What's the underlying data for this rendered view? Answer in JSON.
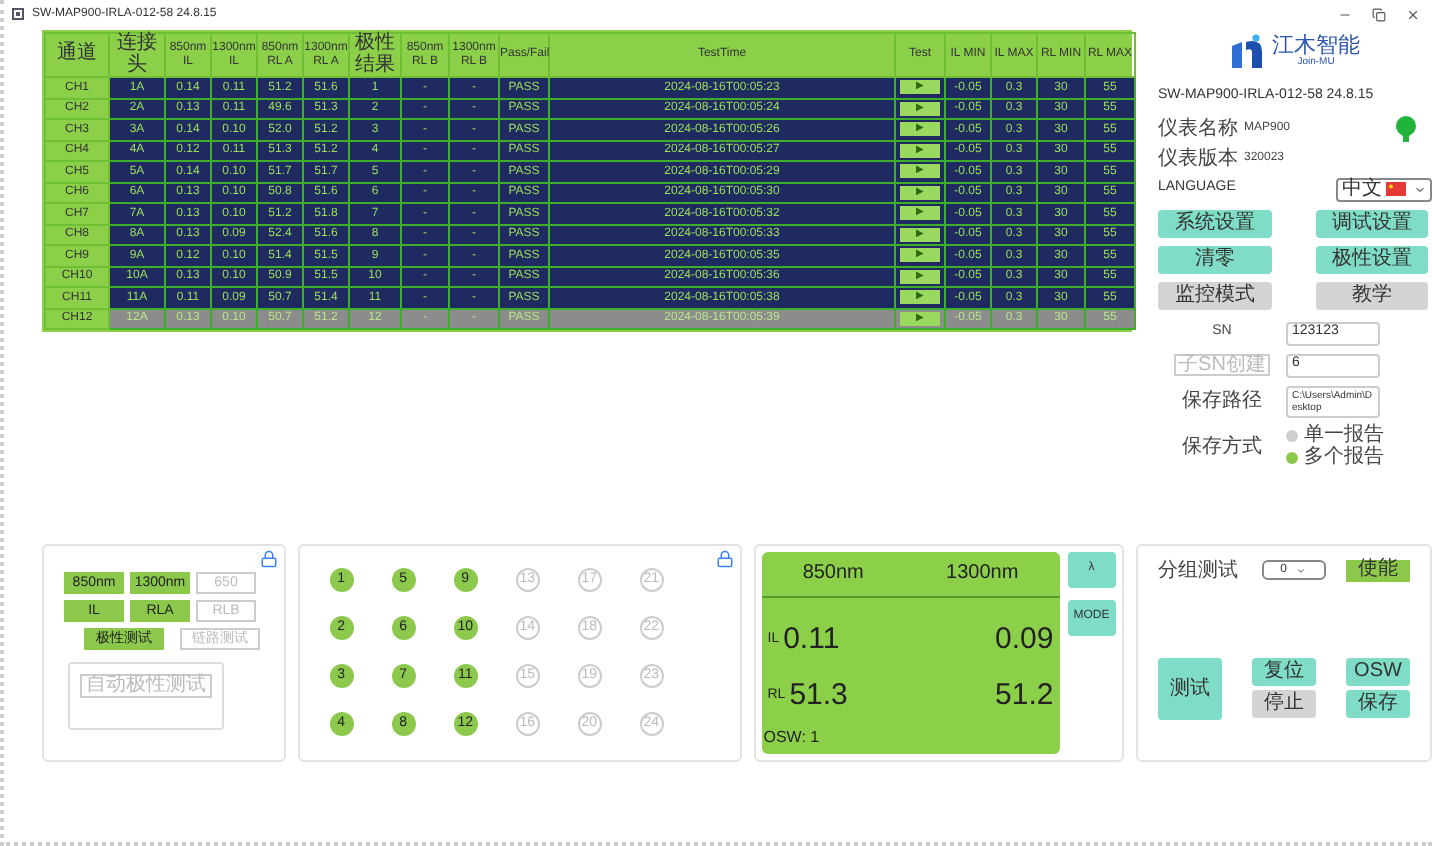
{
  "window": {
    "title": "SW-MAP900-IRLA-012-58 24.8.15"
  },
  "table": {
    "columns": [
      {
        "lines": [
          "通道"
        ]
      },
      {
        "lines": [
          "连接头"
        ]
      },
      {
        "lines": [
          "850nm",
          "IL"
        ]
      },
      {
        "lines": [
          "1300nm",
          "IL"
        ]
      },
      {
        "lines": [
          "850nm",
          "RL A"
        ]
      },
      {
        "lines": [
          "1300nm",
          "RL A"
        ]
      },
      {
        "lines": [
          "极性结果"
        ]
      },
      {
        "lines": [
          "850nm",
          "RL B"
        ]
      },
      {
        "lines": [
          "1300nm",
          "RL B"
        ]
      },
      {
        "lines": [
          "Pass/Fail"
        ]
      },
      {
        "lines": [
          "TestTime"
        ]
      },
      {
        "lines": [
          "Test"
        ]
      },
      {
        "lines": [
          "IL MIN"
        ]
      },
      {
        "lines": [
          "IL MAX"
        ]
      },
      {
        "lines": [
          "RL MIN"
        ]
      },
      {
        "lines": [
          "RL MAX"
        ]
      }
    ],
    "rows": [
      {
        "selected": false,
        "cells": [
          "CH1",
          "1A",
          "0.14",
          "0.11",
          "51.2",
          "51.6",
          "1",
          "-",
          "-",
          "PASS",
          "2024-08-16T00:05:23",
          "▶",
          "-0.05",
          "0.3",
          "30",
          "55"
        ]
      },
      {
        "selected": false,
        "cells": [
          "CH2",
          "2A",
          "0.13",
          "0.11",
          "49.6",
          "51.3",
          "2",
          "-",
          "-",
          "PASS",
          "2024-08-16T00:05:24",
          "▶",
          "-0.05",
          "0.3",
          "30",
          "55"
        ]
      },
      {
        "selected": false,
        "cells": [
          "CH3",
          "3A",
          "0.14",
          "0.10",
          "52.0",
          "51.2",
          "3",
          "-",
          "-",
          "PASS",
          "2024-08-16T00:05:26",
          "▶",
          "-0.05",
          "0.3",
          "30",
          "55"
        ]
      },
      {
        "selected": false,
        "cells": [
          "CH4",
          "4A",
          "0.12",
          "0.11",
          "51.3",
          "51.2",
          "4",
          "-",
          "-",
          "PASS",
          "2024-08-16T00:05:27",
          "▶",
          "-0.05",
          "0.3",
          "30",
          "55"
        ]
      },
      {
        "selected": false,
        "cells": [
          "CH5",
          "5A",
          "0.14",
          "0.10",
          "51.7",
          "51.7",
          "5",
          "-",
          "-",
          "PASS",
          "2024-08-16T00:05:29",
          "▶",
          "-0.05",
          "0.3",
          "30",
          "55"
        ]
      },
      {
        "selected": false,
        "cells": [
          "CH6",
          "6A",
          "0.13",
          "0.10",
          "50.8",
          "51.6",
          "6",
          "-",
          "-",
          "PASS",
          "2024-08-16T00:05:30",
          "▶",
          "-0.05",
          "0.3",
          "30",
          "55"
        ]
      },
      {
        "selected": false,
        "cells": [
          "CH7",
          "7A",
          "0.13",
          "0.10",
          "51.2",
          "51.8",
          "7",
          "-",
          "-",
          "PASS",
          "2024-08-16T00:05:32",
          "▶",
          "-0.05",
          "0.3",
          "30",
          "55"
        ]
      },
      {
        "selected": false,
        "cells": [
          "CH8",
          "8A",
          "0.13",
          "0.09",
          "52.4",
          "51.6",
          "8",
          "-",
          "-",
          "PASS",
          "2024-08-16T00:05:33",
          "▶",
          "-0.05",
          "0.3",
          "30",
          "55"
        ]
      },
      {
        "selected": false,
        "cells": [
          "CH9",
          "9A",
          "0.12",
          "0.10",
          "51.4",
          "51.5",
          "9",
          "-",
          "-",
          "PASS",
          "2024-08-16T00:05:35",
          "▶",
          "-0.05",
          "0.3",
          "30",
          "55"
        ]
      },
      {
        "selected": false,
        "cells": [
          "CH10",
          "10A",
          "0.13",
          "0.10",
          "50.9",
          "51.5",
          "10",
          "-",
          "-",
          "PASS",
          "2024-08-16T00:05:36",
          "▶",
          "-0.05",
          "0.3",
          "30",
          "55"
        ]
      },
      {
        "selected": false,
        "cells": [
          "CH11",
          "11A",
          "0.11",
          "0.09",
          "50.7",
          "51.4",
          "11",
          "-",
          "-",
          "PASS",
          "2024-08-16T00:05:38",
          "▶",
          "-0.05",
          "0.3",
          "30",
          "55"
        ]
      },
      {
        "selected": true,
        "cells": [
          "CH12",
          "12A",
          "0.13",
          "0.10",
          "50.7",
          "51.2",
          "12",
          "-",
          "-",
          "PASS",
          "2024-08-16T00:05:39",
          "▶",
          "-0.05",
          "0.3",
          "30",
          "55"
        ]
      }
    ]
  },
  "logo": {
    "name": "江木智能",
    "sub": "Join-MU"
  },
  "device": {
    "version": "SW-MAP900-IRLA-012-58 24.8.15",
    "name_label": "仪表名称",
    "name": "MAP900",
    "fw_label": "仪表版本",
    "fw": "320023",
    "status_on": true,
    "language_label": "LANGUAGE",
    "language": "中文"
  },
  "settings_buttons": [
    {
      "label": "系统设置",
      "kind": "primary"
    },
    {
      "label": "调试设置",
      "kind": "primary"
    },
    {
      "label": "清零",
      "kind": "primary"
    },
    {
      "label": "极性设置",
      "kind": "primary"
    },
    {
      "label": "监控模式",
      "kind": "secondary"
    },
    {
      "label": "教学",
      "kind": "secondary"
    }
  ],
  "form": {
    "sn_label": "SN",
    "sn": "123123",
    "sub_sn_button": "子SN创建",
    "sub_sn": "6",
    "path_label": "保存路径",
    "path": "C:\\Users\\Admin\\Desktop",
    "mode_label": "保存方式",
    "modes": [
      {
        "label": "单一报告",
        "selected": false
      },
      {
        "label": "多个报告",
        "selected": true
      }
    ]
  },
  "wavelengths": [
    {
      "label": "850nm",
      "on": true
    },
    {
      "label": "1300nm",
      "on": true
    },
    {
      "label": "650",
      "on": false
    }
  ],
  "measures": [
    {
      "label": "IL",
      "on": true
    },
    {
      "label": "RLA",
      "on": true
    },
    {
      "label": "RLB",
      "on": false
    }
  ],
  "test_modes": [
    {
      "label": "极性测试",
      "on": true
    },
    {
      "label": "链路测试",
      "on": false
    }
  ],
  "auto_button": "自动极性测试",
  "ports": [
    {
      "label": "1",
      "on": true
    },
    {
      "label": "2",
      "on": true
    },
    {
      "label": "3",
      "on": true
    },
    {
      "label": "4",
      "on": true
    },
    {
      "label": "5",
      "on": true
    },
    {
      "label": "6",
      "on": true
    },
    {
      "label": "7",
      "on": true
    },
    {
      "label": "8",
      "on": true
    },
    {
      "label": "9",
      "on": true
    },
    {
      "label": "10",
      "on": true
    },
    {
      "label": "11",
      "on": true
    },
    {
      "label": "12",
      "on": true
    },
    {
      "label": "13",
      "on": false
    },
    {
      "label": "14",
      "on": false
    },
    {
      "label": "15",
      "on": false
    },
    {
      "label": "16",
      "on": false
    },
    {
      "label": "17",
      "on": false
    },
    {
      "label": "18",
      "on": false
    },
    {
      "label": "19",
      "on": false
    },
    {
      "label": "20",
      "on": false
    },
    {
      "label": "21",
      "on": false
    },
    {
      "label": "22",
      "on": false
    },
    {
      "label": "23",
      "on": false
    },
    {
      "label": "24",
      "on": false
    }
  ],
  "display": {
    "wavelengths": [
      "850nm",
      "1300nm"
    ],
    "rows": [
      {
        "label": "IL",
        "values": [
          "0.11",
          "0.09"
        ]
      },
      {
        "label": "RL",
        "values": [
          "51.3",
          "51.2"
        ]
      }
    ],
    "osw": "OSW: 1"
  },
  "display_buttons": [
    "λ",
    "MODE"
  ],
  "group": {
    "label": "分组测试",
    "value": "0",
    "enable": "使能"
  },
  "actions": [
    {
      "label": "测试",
      "kind": "primary"
    },
    {
      "label": "复位",
      "kind": "primary"
    },
    {
      "label": "停止",
      "kind": "secondary"
    },
    {
      "label": "OSW",
      "kind": "primary"
    },
    {
      "label": "保存",
      "kind": "primary"
    }
  ]
}
